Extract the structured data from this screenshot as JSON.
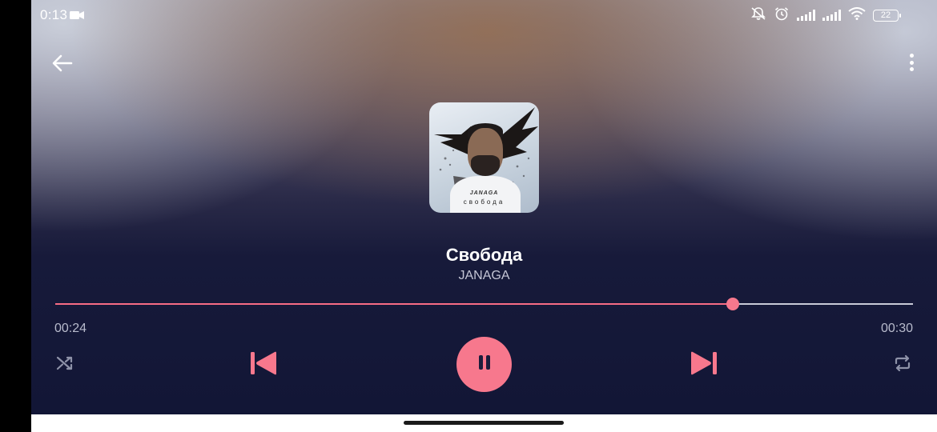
{
  "status_bar": {
    "time": "0:13",
    "battery": "22"
  },
  "player": {
    "title": "Свобода",
    "artist": "JANAGA",
    "elapsed": "00:24",
    "total": "00:30",
    "progress": 0.79
  },
  "cover": {
    "artist_text": "JANAGA",
    "album_text": "свобода"
  },
  "icons": {
    "back": "arrow-left-icon",
    "more": "more-vertical-icon",
    "shuffle": "shuffle-icon",
    "previous": "skip-previous-icon",
    "play_pause": "pause-icon",
    "next": "skip-next-icon",
    "repeat": "repeat-icon"
  },
  "colors": {
    "accent": "#f7788d",
    "background_dark": "#121636",
    "secondary_text": "#c4c6d6"
  }
}
